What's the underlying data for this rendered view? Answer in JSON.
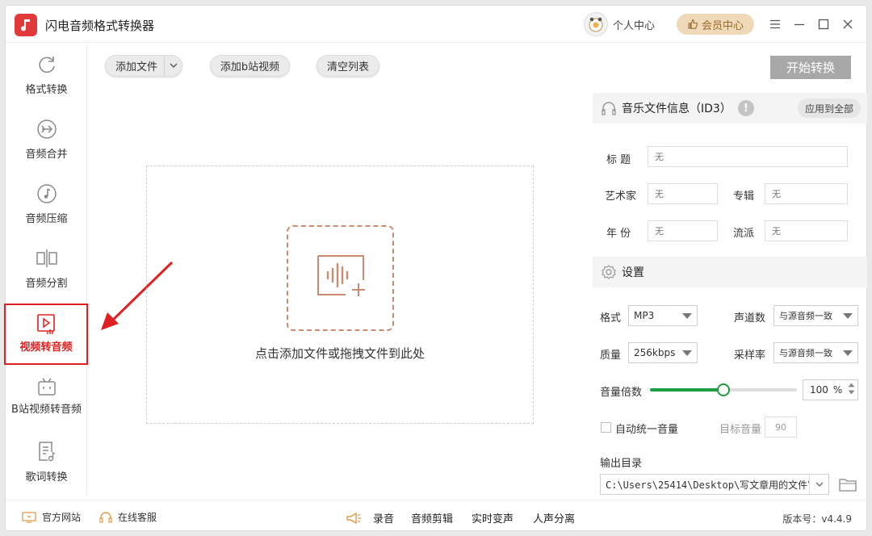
{
  "app": {
    "title": "闪电音频格式转换器"
  },
  "header": {
    "personal_center": "个人中心",
    "vip_center": "会员中心",
    "menu_icon": "hamburger-menu-icon",
    "minimize_icon": "minimize-icon",
    "maximize_icon": "maximize-icon",
    "close_icon": "close-icon"
  },
  "sidebar": {
    "items": [
      {
        "label": "格式转换",
        "icon": "refresh-circle-icon"
      },
      {
        "label": "音频合并",
        "icon": "merge-arrows-icon"
      },
      {
        "label": "音频压缩",
        "icon": "music-note-icon"
      },
      {
        "label": "音频分割",
        "icon": "split-icon"
      },
      {
        "label": "视频转音频",
        "icon": "video-play-icon",
        "active": true
      },
      {
        "label": "B站视频转音频",
        "icon": "bilibili-icon"
      },
      {
        "label": "歌词转换",
        "icon": "lyrics-icon"
      }
    ]
  },
  "toolbar": {
    "add_file": "添加文件",
    "add_bilibili": "添加b站视频",
    "clear_list": "清空列表",
    "start_convert": "开始转换"
  },
  "dropzone": {
    "hint": "点击添加文件或拖拽文件到此处"
  },
  "id3": {
    "title": "音乐文件信息（ID3）",
    "apply_all": "应用到全部",
    "fields": {
      "title_label": "标  题",
      "artist_label": "艺术家",
      "album_label": "专辑",
      "year_label": "年  份",
      "genre_label": "流派",
      "placeholder": "无"
    }
  },
  "settings": {
    "title": "设置",
    "format_label": "格式",
    "format_value": "MP3",
    "channels_label": "声道数",
    "channels_value": "与源音频一致",
    "quality_label": "质量",
    "quality_value": "256kbps",
    "samplerate_label": "采样率",
    "samplerate_value": "与源音频一致",
    "volume_label": "音量倍数",
    "volume_value": "100",
    "volume_unit": "%",
    "volume_fraction": 0.5,
    "auto_volume_label": "自动统一音量",
    "auto_volume_checked": false,
    "target_volume_label": "目标音量",
    "target_volume_value": "90",
    "output_label": "输出目录",
    "output_path": "C:\\Users\\25414\\Desktop\\写文章用的文件\\..."
  },
  "footer": {
    "website": "官方网站",
    "support": "在线客服",
    "record": "录音",
    "audio_edit": "音频剪辑",
    "realtime_voice": "实时变声",
    "vocal_split": "人声分离",
    "version": "版本号：v4.4.9"
  },
  "colors": {
    "accent_red": "#e02020",
    "slider_green": "#1a9e3f",
    "logo_red": "#e23a3a",
    "vip_gold": "#efd9b9",
    "drop_icon": "#c98b72"
  }
}
